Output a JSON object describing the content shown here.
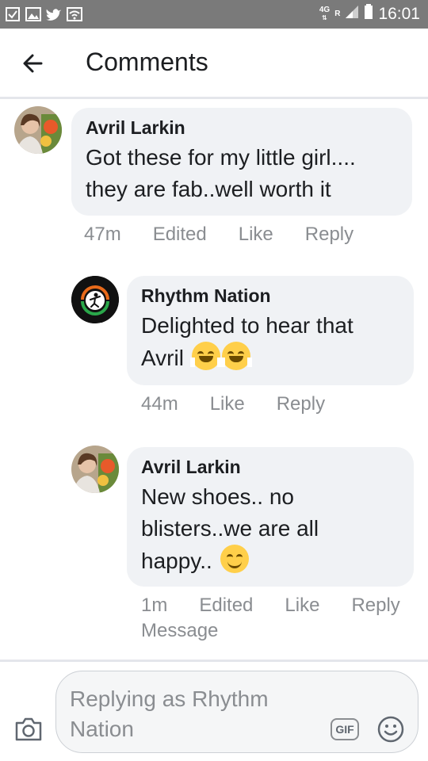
{
  "status_bar": {
    "time": "16:01",
    "network": "4G",
    "roaming": "R",
    "icons_left": [
      "checklist-icon",
      "gallery-icon",
      "twitter-icon",
      "wifi-icon"
    ]
  },
  "header": {
    "title": "Comments",
    "back_icon": "back-arrow-icon"
  },
  "comments": [
    {
      "author": "Avril Larkin",
      "text": "Got these for my little girl.... they are fab..well worth it",
      "time": "47m",
      "edited": "Edited",
      "like": "Like",
      "reply": "Reply",
      "avatar": "avatar-photo"
    },
    {
      "author": "Rhythm Nation",
      "text_line1": "Delighted to hear that",
      "text_line2": "Avril",
      "emoji": "hugging-face-emoji",
      "time": "44m",
      "like": "Like",
      "reply": "Reply",
      "avatar": "rhythm-nation-logo"
    },
    {
      "author": "Avril Larkin",
      "text_line1": "New shoes.. no",
      "text_line2": "blisters..we are all",
      "text_line3": "happy..",
      "emoji": "smiling-face-emoji",
      "time": "1m",
      "edited": "Edited",
      "like": "Like",
      "reply": "Reply",
      "message": "Message",
      "avatar": "avatar-photo"
    }
  ],
  "composer": {
    "placeholder": "Replying as Rhythm Nation",
    "gif_label": "GIF",
    "camera_icon": "camera-icon",
    "emoji_icon": "emoji-icon"
  }
}
